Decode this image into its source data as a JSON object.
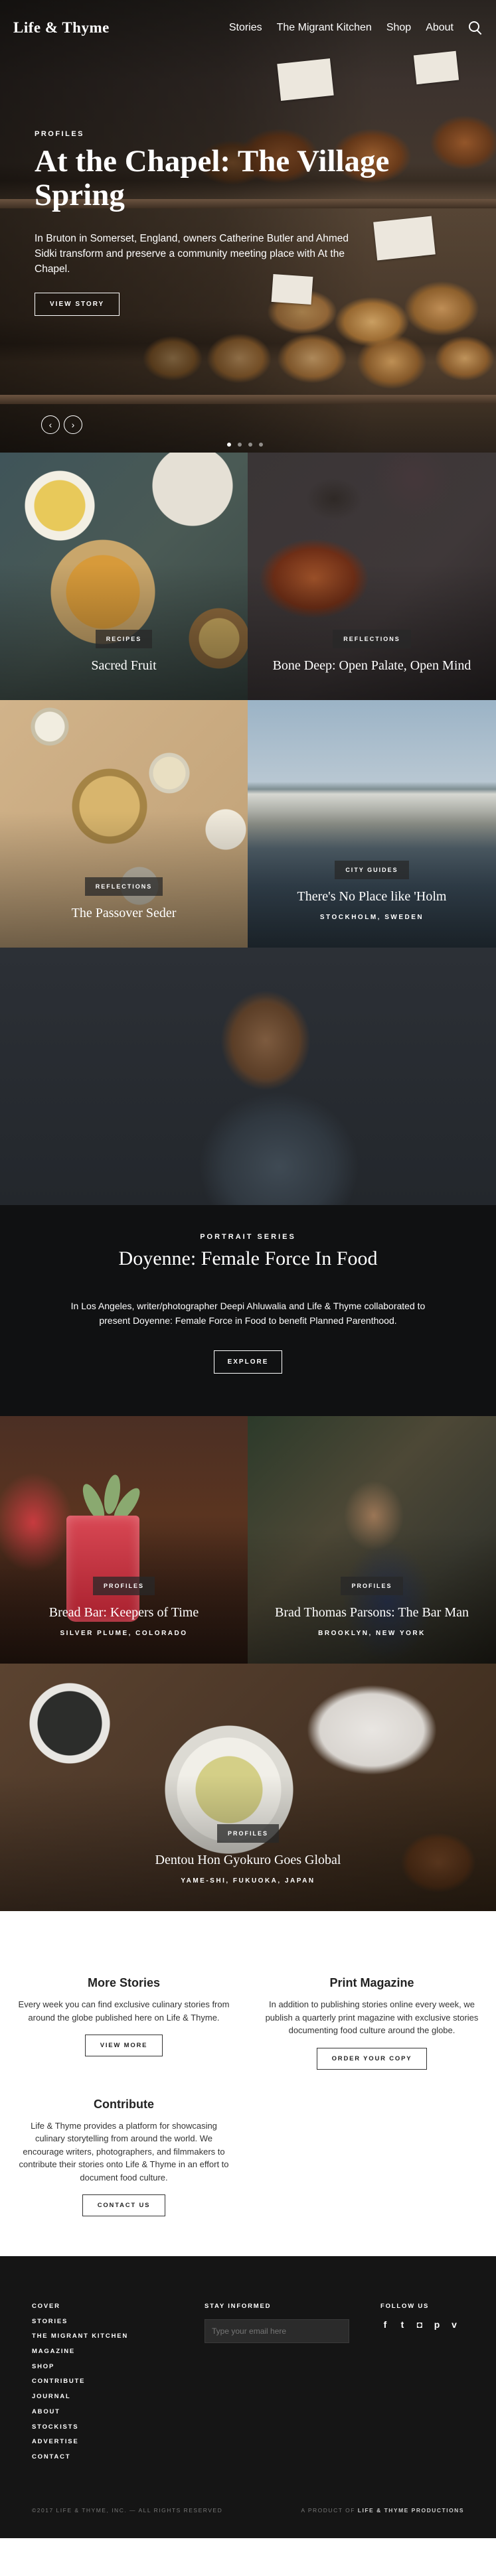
{
  "header": {
    "logo": "Life & Thyme",
    "nav": [
      "Stories",
      "The Migrant Kitchen",
      "Shop",
      "About"
    ]
  },
  "hero": {
    "kicker": "PROFILES",
    "title": "At the Chapel: The Village Spring",
    "description": "In Bruton in Somerset, England, owners Catherine Butler and Ahmed Sidki transform and preserve a community meeting place with At the Chapel.",
    "button": "VIEW STORY",
    "prev_arrow": "‹",
    "next_arrow": "›"
  },
  "tiles_row1": [
    {
      "badge": "RECIPES",
      "title": "Sacred Fruit",
      "location": ""
    },
    {
      "badge": "REFLECTIONS",
      "title": "Bone Deep: Open Palate, Open Mind",
      "location": ""
    }
  ],
  "tiles_row2": [
    {
      "badge": "REFLECTIONS",
      "title": "The Passover Seder",
      "location": ""
    },
    {
      "badge": "CITY GUIDES",
      "title": "There's No Place like 'Holm",
      "location": "STOCKHOLM, SWEDEN"
    }
  ],
  "portrait_series": {
    "kicker": "PORTRAIT SERIES",
    "title": "Doyenne: Female Force In Food",
    "description": "In Los Angeles, writer/photographer Deepi Ahluwalia and Life & Thyme collaborated to present Doyenne: Female Force in Food to benefit Planned Parenthood.",
    "button": "EXPLORE"
  },
  "tiles_row3": [
    {
      "badge": "PROFILES",
      "title": "Bread Bar: Keepers of Time",
      "location": "SILVER PLUME, COLORADO"
    },
    {
      "badge": "PROFILES",
      "title": "Brad Thomas Parsons: The Bar Man",
      "location": "BROOKLYN, NEW YORK"
    }
  ],
  "tea_tile": {
    "badge": "PROFILES",
    "title": "Dentou Hon Gyokuro Goes Global",
    "location": "YAME-SHI, FUKUOKA, JAPAN"
  },
  "more_stories": {
    "title": "More Stories",
    "text": "Every week you can find exclusive culinary stories from around the globe published here on Life & Thyme.",
    "button": "VIEW MORE"
  },
  "print_magazine": {
    "title": "Print Magazine",
    "text": "In addition to publishing stories online every week, we publish a quarterly print magazine with exclusive stories documenting food culture around the globe.",
    "button": "ORDER YOUR COPY"
  },
  "contribute": {
    "title": "Contribute",
    "text": "Life & Thyme provides a platform for showcasing culinary storytelling from around the world. We encourage writers, photographers, and filmmakers to contribute their stories onto Life & Thyme in an effort to document food culture.",
    "button": "CONTACT US"
  },
  "footer": {
    "links": [
      "COVER",
      "STORIES",
      "THE MIGRANT KITCHEN",
      "MAGAZINE",
      "SHOP",
      "CONTRIBUTE",
      "JOURNAL",
      "ABOUT",
      "STOCKISTS",
      "ADVERTISE",
      "CONTACT"
    ],
    "newsletter_heading": "STAY INFORMED",
    "newsletter_placeholder": "Type your email here",
    "social_heading": "FOLLOW US",
    "social_icons": [
      "f",
      "t",
      "ig",
      "p",
      "v"
    ],
    "copyright": "©2017 LIFE & THYME, INC. — ALL RIGHTS RESERVED",
    "product_prefix": "A PRODUCT OF",
    "product_name": "LIFE & THYME PRODUCTIONS"
  }
}
